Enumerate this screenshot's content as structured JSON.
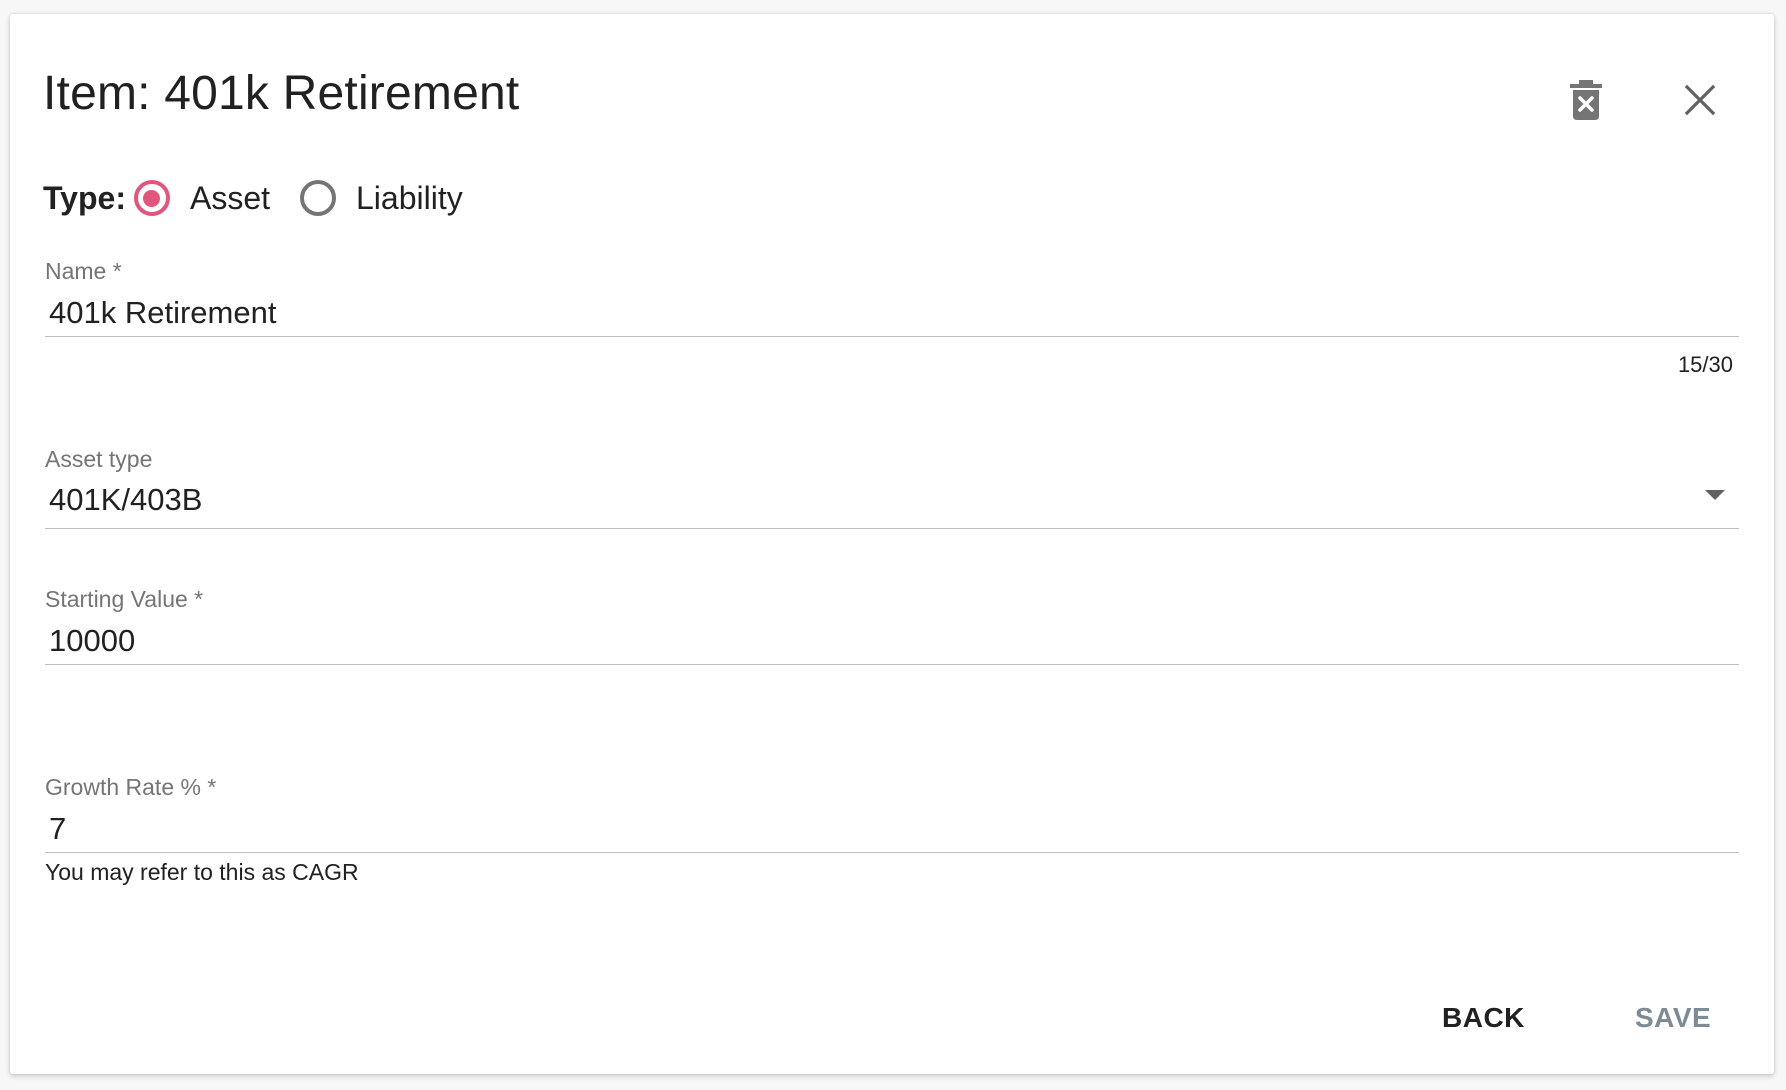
{
  "dialog": {
    "title": "Item: 401k Retirement",
    "delete_icon": "delete-forever-icon",
    "close_icon": "close-icon"
  },
  "type": {
    "label": "Type:",
    "options": [
      {
        "label": "Asset",
        "checked": true
      },
      {
        "label": "Liability",
        "checked": false
      }
    ]
  },
  "fields": {
    "name": {
      "label": "Name",
      "required_mark": "*",
      "value": "401k Retirement",
      "counter": "15/30"
    },
    "asset_type": {
      "label": "Asset type",
      "value": "401K/403B"
    },
    "starting_value": {
      "label": "Starting Value",
      "required_mark": "*",
      "value": "10000"
    },
    "growth_rate": {
      "label": "Growth Rate %",
      "required_mark": "*",
      "value": "7",
      "helper": "You may refer to this as CAGR"
    }
  },
  "actions": {
    "back_label": "BACK",
    "save_label": "SAVE"
  },
  "colors": {
    "accent": "#e0567d",
    "save_disabled": "#7c8b96"
  }
}
